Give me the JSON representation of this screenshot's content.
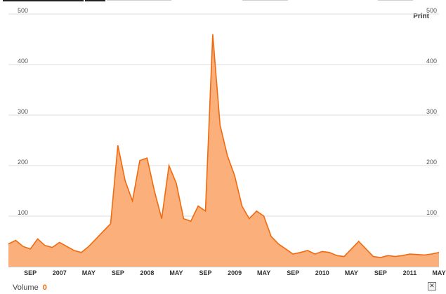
{
  "toolbar": {
    "print_label": "Print",
    "close_icon": "close-icon"
  },
  "volume": {
    "label": "Volume",
    "value": "0"
  },
  "colors": {
    "line": "#f06a10",
    "fill": "#fbb07c",
    "grid": "#dddddd"
  },
  "chart_data": {
    "type": "area",
    "title": "",
    "xlabel": "",
    "ylabel": "",
    "ylim": [
      0,
      500
    ],
    "yticks": [
      100,
      200,
      300,
      400,
      500
    ],
    "grid": true,
    "x_range": [
      "2006-06",
      "2011-05"
    ],
    "xticks": [
      {
        "label": "SEP",
        "date": "2006-09"
      },
      {
        "label": "2007",
        "date": "2007-01"
      },
      {
        "label": "MAY",
        "date": "2007-05"
      },
      {
        "label": "SEP",
        "date": "2007-09"
      },
      {
        "label": "2008",
        "date": "2008-01"
      },
      {
        "label": "MAY",
        "date": "2008-05"
      },
      {
        "label": "SEP",
        "date": "2008-09"
      },
      {
        "label": "2009",
        "date": "2009-01"
      },
      {
        "label": "MAY",
        "date": "2009-05"
      },
      {
        "label": "SEP",
        "date": "2009-09"
      },
      {
        "label": "2010",
        "date": "2010-01"
      },
      {
        "label": "MAY",
        "date": "2010-05"
      },
      {
        "label": "SEP",
        "date": "2010-09"
      },
      {
        "label": "2011",
        "date": "2011-01"
      },
      {
        "label": "MAY",
        "date": "2011-05"
      }
    ],
    "series": [
      {
        "x": [
          "2006-06",
          "2006-07",
          "2006-08",
          "2006-09",
          "2006-10",
          "2006-11",
          "2006-12",
          "2007-01",
          "2007-02",
          "2007-03",
          "2007-04",
          "2007-05",
          "2007-06",
          "2007-07",
          "2007-08",
          "2007-09",
          "2007-10",
          "2007-11",
          "2007-12",
          "2008-01",
          "2008-02",
          "2008-03",
          "2008-04",
          "2008-05",
          "2008-06",
          "2008-07",
          "2008-08",
          "2008-09",
          "2008-10",
          "2008-11",
          "2008-12",
          "2009-01",
          "2009-02",
          "2009-03",
          "2009-04",
          "2009-05",
          "2009-06",
          "2009-07",
          "2009-08",
          "2009-09",
          "2009-10",
          "2009-11",
          "2009-12",
          "2010-01",
          "2010-02",
          "2010-03",
          "2010-04",
          "2010-05",
          "2010-06",
          "2010-07",
          "2010-08",
          "2010-09",
          "2010-10",
          "2010-11",
          "2010-12",
          "2011-01",
          "2011-02",
          "2011-03",
          "2011-04",
          "2011-05"
        ],
        "values": [
          45,
          52,
          40,
          35,
          55,
          42,
          38,
          48,
          40,
          32,
          28,
          40,
          55,
          70,
          85,
          240,
          170,
          130,
          210,
          215,
          150,
          95,
          200,
          165,
          95,
          90,
          120,
          110,
          460,
          280,
          220,
          180,
          120,
          95,
          110,
          100,
          60,
          45,
          35,
          25,
          28,
          32,
          25,
          30,
          28,
          22,
          20,
          35,
          50,
          35,
          20,
          18,
          22,
          20,
          22,
          25,
          24,
          23,
          25,
          28
        ]
      }
    ]
  }
}
